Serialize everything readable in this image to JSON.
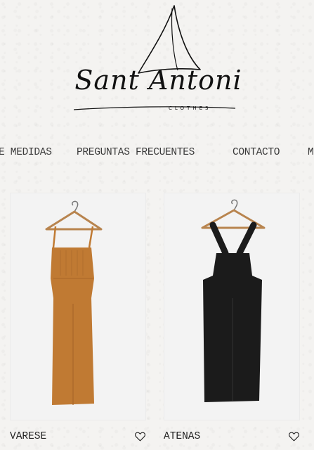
{
  "brand": {
    "name": "Sant Antoni",
    "tagline": "CLOTHES"
  },
  "nav": {
    "items": [
      {
        "label": "E MEDIDAS"
      },
      {
        "label": "PREGUNTAS FRECUENTES"
      },
      {
        "label": "CONTACTO"
      },
      {
        "label": "M"
      }
    ]
  },
  "products": [
    {
      "name": "VARESE",
      "color": "#c07a33",
      "icon": "heart-outline-icon"
    },
    {
      "name": "ATENAS",
      "color": "#1b1b1b",
      "icon": "heart-outline-icon"
    }
  ]
}
